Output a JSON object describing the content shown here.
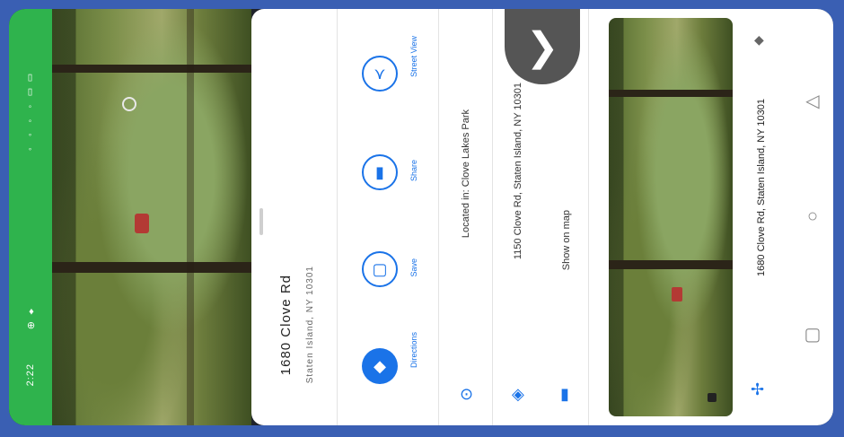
{
  "status_bar": {
    "time": "2:22",
    "icons": "⊕ ♦",
    "right_icons": "◦ ◦ ◦ ◦ ▯ ▯"
  },
  "place": {
    "title": "1680 Clove Rd",
    "subtitle": "Staten Island, NY 10301"
  },
  "actions": [
    {
      "label": "Directions",
      "icon": "◆"
    },
    {
      "label": "Save",
      "icon": "▢"
    },
    {
      "label": "Share",
      "icon": "▮"
    },
    {
      "label": "Street View",
      "icon": "⋎"
    }
  ],
  "info": [
    {
      "text": "Located in: Clove Lakes Park",
      "icon": "⊙"
    },
    {
      "text": "1150 Clove Rd, Staten Island, NY 10301",
      "icon": "◈"
    },
    {
      "text": "Show on map",
      "icon": "▮"
    }
  ],
  "next_glyph": "❯",
  "search_text": "1680 Clove Rd, Staten Island, NY 10301",
  "nav": {
    "back": "◁",
    "home": "○",
    "recent": "▢"
  },
  "colors": {
    "accent": "#1a73e8",
    "status": "#2fb34d"
  }
}
